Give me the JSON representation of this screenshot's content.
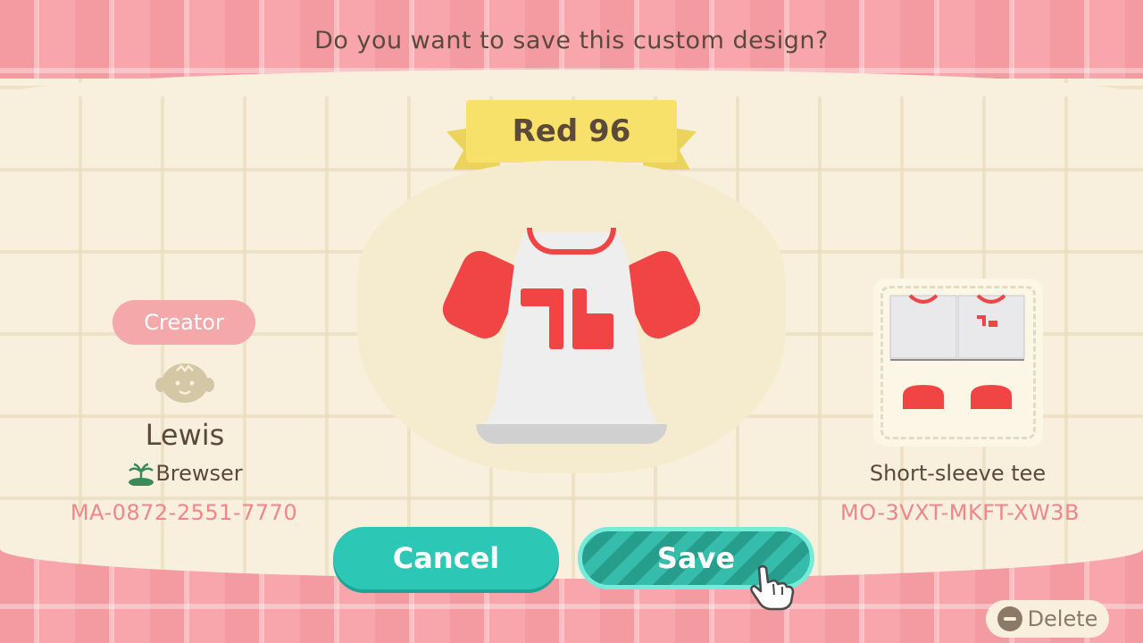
{
  "prompt": {
    "question": "Do you want to save this custom design?"
  },
  "design": {
    "title": "Red 96",
    "type": "Short-sleeve tee",
    "design_code": "MO-3VXT-MKFT-XW3B"
  },
  "creator": {
    "badge_label": "Creator",
    "name": "Lewis",
    "island": "Brewser",
    "creator_code": "MA-0872-2551-7770"
  },
  "buttons": {
    "cancel_label": "Cancel",
    "save_label": "Save",
    "delete_label": "Delete"
  },
  "colors": {
    "shirt_red": "#f14545",
    "button_teal": "#2dc7b5",
    "creator_pink": "#f4a8aa",
    "ribbon_yellow": "#f7e16a"
  },
  "icons": {
    "avatar": "villager-face-icon",
    "island": "island-palm-icon",
    "cursor": "pointing-hand-icon",
    "delete": "minus-circle-icon"
  }
}
